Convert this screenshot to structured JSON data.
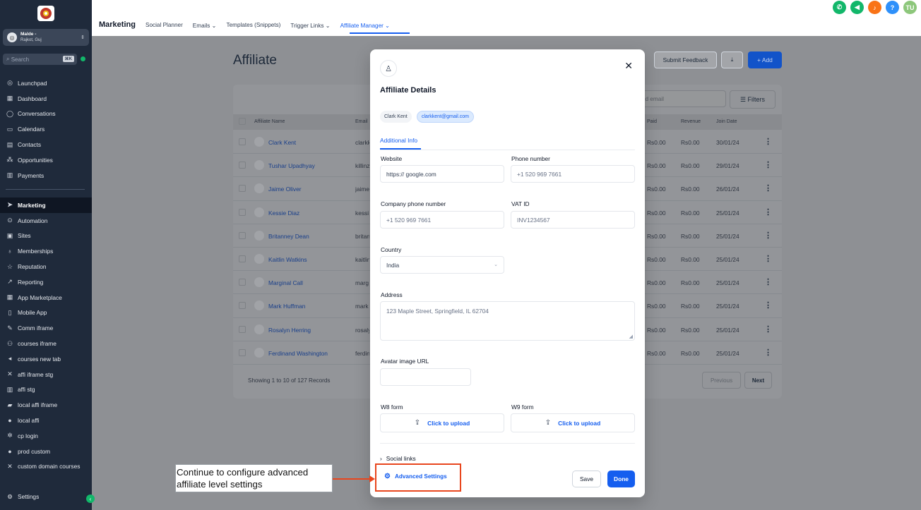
{
  "sidebar": {
    "account": {
      "name": "Malde -",
      "location": "Rajkot, Guj"
    },
    "search": {
      "placeholder": "Search",
      "shortcut": "⌘K"
    },
    "items": [
      {
        "label": "Launchpad",
        "icon": "rocket-icon"
      },
      {
        "label": "Dashboard",
        "icon": "grid-icon"
      },
      {
        "label": "Conversations",
        "icon": "chat-icon"
      },
      {
        "label": "Calendars",
        "icon": "calendar-icon"
      },
      {
        "label": "Contacts",
        "icon": "contacts-icon"
      },
      {
        "label": "Opportunities",
        "icon": "opportunities-icon"
      },
      {
        "label": "Payments",
        "icon": "payments-icon"
      }
    ],
    "items2": [
      {
        "label": "Marketing",
        "icon": "send-icon",
        "active": true
      },
      {
        "label": "Automation",
        "icon": "automation-icon"
      },
      {
        "label": "Sites",
        "icon": "sites-icon"
      },
      {
        "label": "Memberships",
        "icon": "memberships-icon"
      },
      {
        "label": "Reputation",
        "icon": "star-icon"
      },
      {
        "label": "Reporting",
        "icon": "trend-icon"
      },
      {
        "label": "App Marketplace",
        "icon": "apps-icon"
      },
      {
        "label": "Mobile App",
        "icon": "mobile-icon"
      },
      {
        "label": "Comm iframe",
        "icon": "pen-icon"
      },
      {
        "label": "courses iframe",
        "icon": "user-plus-icon"
      },
      {
        "label": "courses new tab",
        "icon": "speaker-icon"
      },
      {
        "label": "affi iframe stg",
        "icon": "tools-icon"
      },
      {
        "label": "affi stg",
        "icon": "bank-icon"
      },
      {
        "label": "local affi iframe",
        "icon": "lock-icon"
      },
      {
        "label": "local affi",
        "icon": "globe-icon"
      },
      {
        "label": "cp login",
        "icon": "gear-icon"
      },
      {
        "label": "prod custom",
        "icon": "globe-icon"
      },
      {
        "label": "custom domain courses",
        "icon": "tools-icon"
      }
    ],
    "settings": "Settings"
  },
  "topbar": {
    "section": "Marketing",
    "tabs": [
      {
        "label": "Social Planner"
      },
      {
        "label": "Emails ⌄"
      },
      {
        "label": "Templates (Snippets)"
      },
      {
        "label": "Trigger Links ⌄"
      },
      {
        "label": "Affiliate Manager ⌄",
        "active": true
      }
    ],
    "user_initials": "TU",
    "help": "?"
  },
  "page": {
    "title": "Affiliate",
    "submit_feedback": "Submit Feedback",
    "add": "+ Add",
    "search_placeholder": "nd email",
    "filters": "Filters",
    "columns": {
      "name": "Affiliate Name",
      "email": "Email",
      "paid": "Paid",
      "revenue": "Revenue",
      "join_date": "Join Date"
    },
    "rows": [
      {
        "name": "Clark Kent",
        "email": "clarkk",
        "paid": "Rs0.00",
        "revenue": "Rs0.00",
        "date": "30/01/24"
      },
      {
        "name": "Tushar Upadhyay",
        "email": "killinz",
        "paid": "Rs0.00",
        "revenue": "Rs0.00",
        "date": "29/01/24"
      },
      {
        "name": "Jaime Oliver",
        "email": "jaime",
        "paid": "Rs0.00",
        "revenue": "Rs0.00",
        "date": "26/01/24"
      },
      {
        "name": "Kessie Diaz",
        "email": "kessi",
        "paid": "Rs0.00",
        "revenue": "Rs0.00",
        "date": "25/01/24"
      },
      {
        "name": "Britanney Dean",
        "email": "britan",
        "paid": "Rs0.00",
        "revenue": "Rs0.00",
        "date": "25/01/24"
      },
      {
        "name": "Kaitlin Watkins",
        "email": "kaitlin",
        "paid": "Rs0.00",
        "revenue": "Rs0.00",
        "date": "25/01/24"
      },
      {
        "name": "Marginal Call",
        "email": "marg",
        "paid": "Rs0.00",
        "revenue": "Rs0.00",
        "date": "25/01/24"
      },
      {
        "name": "Mark Huffman",
        "email": "mark",
        "paid": "Rs0.00",
        "revenue": "Rs0.00",
        "date": "25/01/24"
      },
      {
        "name": "Rosalyn Herring",
        "email": "rosaly",
        "paid": "Rs0.00",
        "revenue": "Rs0.00",
        "date": "25/01/24"
      },
      {
        "name": "Ferdinand Washington",
        "email": "ferdin",
        "paid": "Rs0.00",
        "revenue": "Rs0.00",
        "date": "25/01/24"
      }
    ],
    "records": "Showing 1 to 10 of 127 Records",
    "previous": "Previous",
    "next": "Next"
  },
  "modal": {
    "title": "Affiliate Details",
    "name_chip": "Clark Kent",
    "email_chip": "clarkkent@gmail.com",
    "tab": "Additional Info",
    "website_label": "Website",
    "website_value": "https:// google.com",
    "phone_label": "Phone number",
    "phone_placeholder": "+1 520 969 7661",
    "company_phone_label": "Company phone number",
    "company_phone_placeholder": "+1 520 969 7661",
    "vat_label": "VAT ID",
    "vat_placeholder": "INV1234567",
    "country_label": "Country",
    "country_value": "India",
    "address_label": "Address",
    "address_placeholder": "123 Maple Street, Springfield, IL 62704",
    "avatar_label": "Avatar image URL",
    "w8_label": "W8 form",
    "w9_label": "W9 form",
    "upload_label": "Click to upload",
    "social_links": "Social links",
    "advanced_settings": "Advanced Settings",
    "save": "Save",
    "done": "Done"
  },
  "annotation": {
    "text_line1": "Continue to configure advanced",
    "text_line2": "affiliate level settings",
    "color": "#e8461d"
  }
}
